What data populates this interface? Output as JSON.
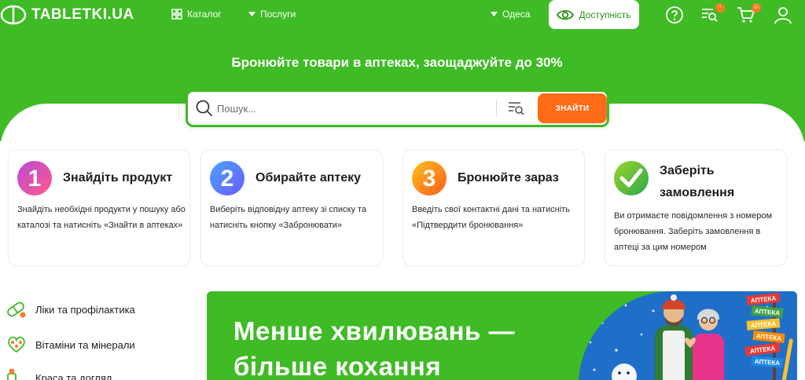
{
  "header": {
    "logo_text": "TABLETKI.UA",
    "catalog_label": "Каталог",
    "services_label": "Послуги",
    "city_label": "Одеса",
    "accessibility_label": "Доступність",
    "orders_badge": "+",
    "cart_badge": "0"
  },
  "hero": {
    "tagline": "Бронюйте товари в аптеках, заощаджуйте до 30%"
  },
  "search": {
    "placeholder": "Пошук...",
    "button_label": "ЗНАЙТИ"
  },
  "steps": [
    {
      "number": "1",
      "title": "Знайдіть продукт",
      "description": "Знайдіть необхідні продукти у пошуку або каталозі та натисніть «Знайти в аптеках»"
    },
    {
      "number": "2",
      "title": "Обирайте аптеку",
      "description": "Виберіть відповідну аптеку зі списку та натисніть кнопку «Забронювати»"
    },
    {
      "number": "3",
      "title": "Бронюйте зараз",
      "description": "Введіть свої контактні дані та натисніть «Підтвердити бронювання»"
    },
    {
      "number": "✓",
      "title": "Заберіть замовлення",
      "description": "Ви отримаєте повідомлення з номером бронювання. Заберіть замовлення в аптеці за цим номером"
    }
  ],
  "categories": [
    {
      "label": "Ліки та профілактика",
      "icon": "pill-icon"
    },
    {
      "label": "Вітаміни та мінерали",
      "icon": "vitamins-icon"
    },
    {
      "label": "Краса та догляд",
      "icon": "beauty-icon"
    }
  ],
  "banner": {
    "line1": "Менше хвилювань —",
    "line2": "більше кохання",
    "signs": [
      "АПТЕКА",
      "АПТЕКА",
      "АПТЕКА",
      "АПТЕКА",
      "АПТЕКА",
      "АПТЕКА"
    ]
  },
  "colors": {
    "brand_green": "#3fbb25",
    "accent_orange": "#ff6b17",
    "text_dark": "#1d1d1d"
  }
}
